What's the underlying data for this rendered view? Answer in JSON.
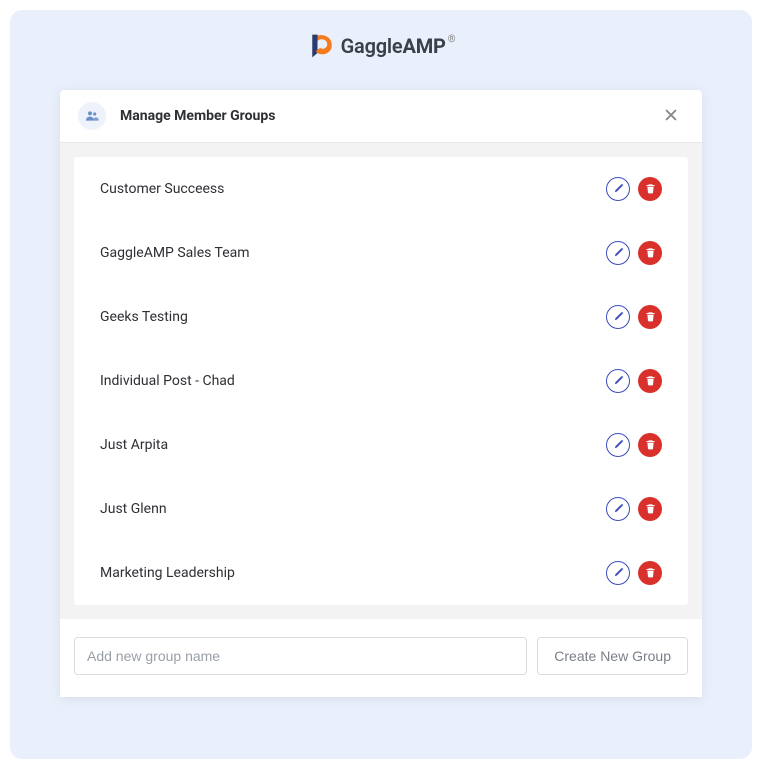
{
  "brand": {
    "name_part1": "Gaggle",
    "name_part2": "AMP"
  },
  "modal": {
    "title": "Manage Member Groups"
  },
  "groups": [
    {
      "name": "Customer Succeess"
    },
    {
      "name": "GaggleAMP Sales Team"
    },
    {
      "name": "Geeks Testing"
    },
    {
      "name": "Individual Post - Chad"
    },
    {
      "name": "Just Arpita"
    },
    {
      "name": "Just Glenn"
    },
    {
      "name": "Marketing Leadership"
    }
  ],
  "footer": {
    "input_placeholder": "Add new group name",
    "create_label": "Create New Group"
  }
}
